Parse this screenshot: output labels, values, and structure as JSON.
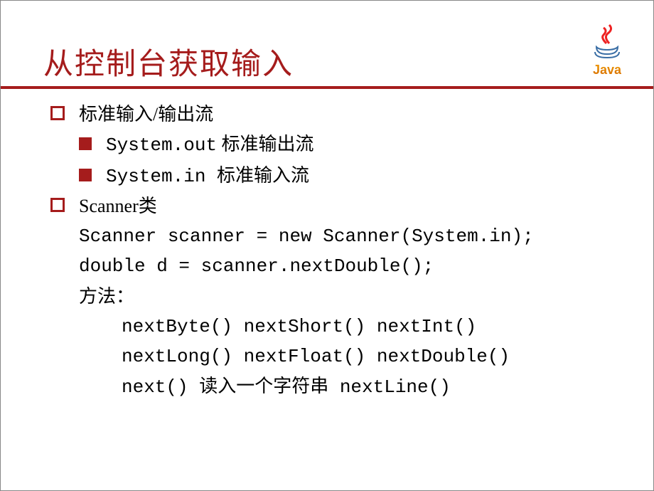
{
  "logo": {
    "text": "Java"
  },
  "title": "从控制台获取输入",
  "content": {
    "p1": {
      "text": "标准输入/输出流"
    },
    "p2": {
      "code": "System.out",
      "desc": "标准输出流"
    },
    "p3": {
      "code": "System.in ",
      "desc": "标准输入流"
    },
    "p4": {
      "text": "Scanner类"
    },
    "p5": "Scanner scanner = new Scanner(System.in);",
    "p6": "double d = scanner.nextDouble();",
    "p7": "方法：",
    "p8": "nextByte() nextShort() nextInt()",
    "p9": "nextLong() nextFloat() nextDouble()",
    "p10": "next() 读入一个字符串 nextLine()"
  }
}
